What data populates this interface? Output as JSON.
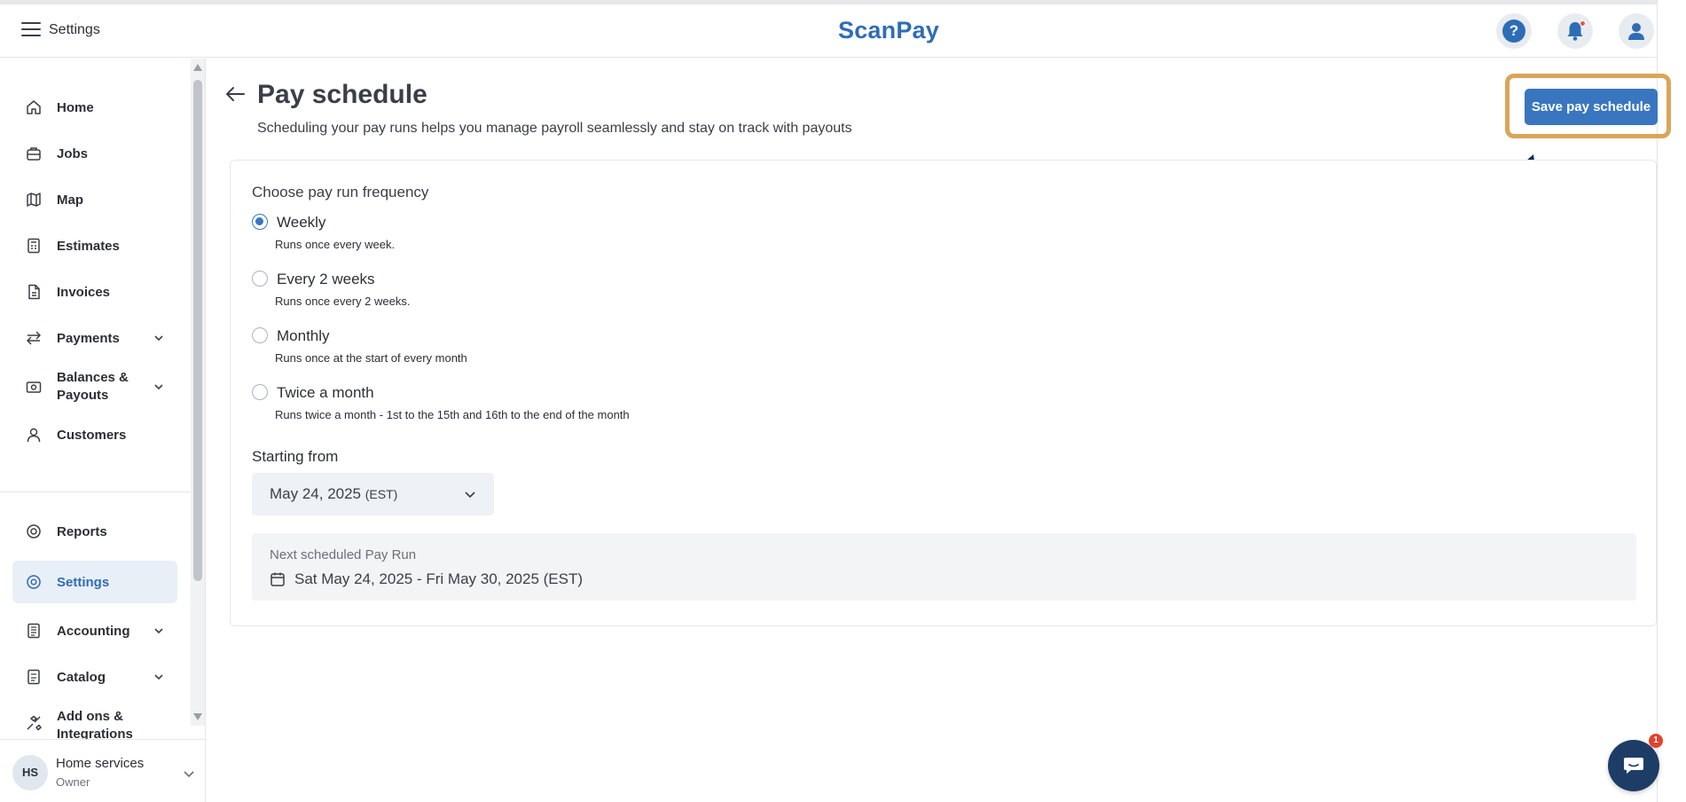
{
  "header": {
    "menu_label": "Settings",
    "logo": "ScanPay",
    "icons": [
      "help-icon",
      "bell-icon",
      "user-icon"
    ]
  },
  "sidebar": {
    "items": [
      {
        "label": "Home",
        "icon": "home-icon"
      },
      {
        "label": "Jobs",
        "icon": "briefcase-icon"
      },
      {
        "label": "Map",
        "icon": "map-icon"
      },
      {
        "label": "Estimates",
        "icon": "calculator-icon"
      },
      {
        "label": "Invoices",
        "icon": "document-icon"
      },
      {
        "label": "Payments",
        "icon": "payments-icon"
      },
      {
        "label_line1": "Balances &",
        "label_line2": "Payouts",
        "icon": "cash-icon"
      },
      {
        "label": "Customers",
        "icon": "person-icon"
      },
      {
        "label": "Reports",
        "icon": "reports-icon"
      },
      {
        "label": "Settings",
        "icon": "gear-icon"
      },
      {
        "label": "Accounting",
        "icon": "ledger-icon"
      },
      {
        "label": "Catalog",
        "icon": "catalog-icon"
      },
      {
        "label_line1": "Add ons &",
        "label_line2": "Integrations",
        "icon": "puzzle-icon"
      }
    ],
    "active": "Settings",
    "user": {
      "initials": "HS",
      "name": "Home services",
      "role": "Owner"
    }
  },
  "main": {
    "title": "Pay schedule",
    "subtitle": "Scheduling your pay runs helps you manage payroll seamlessly and stay on track with payouts",
    "save_label": "Save pay schedule",
    "section_label": "Choose pay run frequency",
    "options": [
      {
        "label": "Weekly",
        "desc": "Runs once every week.",
        "selected": true
      },
      {
        "label": "Every 2 weeks",
        "desc": "Runs once every 2 weeks.",
        "selected": false
      },
      {
        "label": "Monthly",
        "desc": "Runs once at the start of every month",
        "selected": false
      },
      {
        "label": "Twice a month",
        "desc": "Runs twice a month - 1st to the 15th and 16th to the end of the month",
        "selected": false
      }
    ],
    "starting_label": "Starting from",
    "start_date": "May 24, 2025",
    "start_tz": "(EST)",
    "next_title": "Next scheduled Pay Run",
    "next_range": "Sat May 24, 2025 - Fri May 30, 2025 (EST)"
  },
  "chat": {
    "badge": "1"
  },
  "colors": {
    "brand": "#2e6db5",
    "button": "#3a76bf",
    "highlight": "#d9a55a",
    "arrow": "#0f2d63",
    "chat": "#1d3d66"
  }
}
